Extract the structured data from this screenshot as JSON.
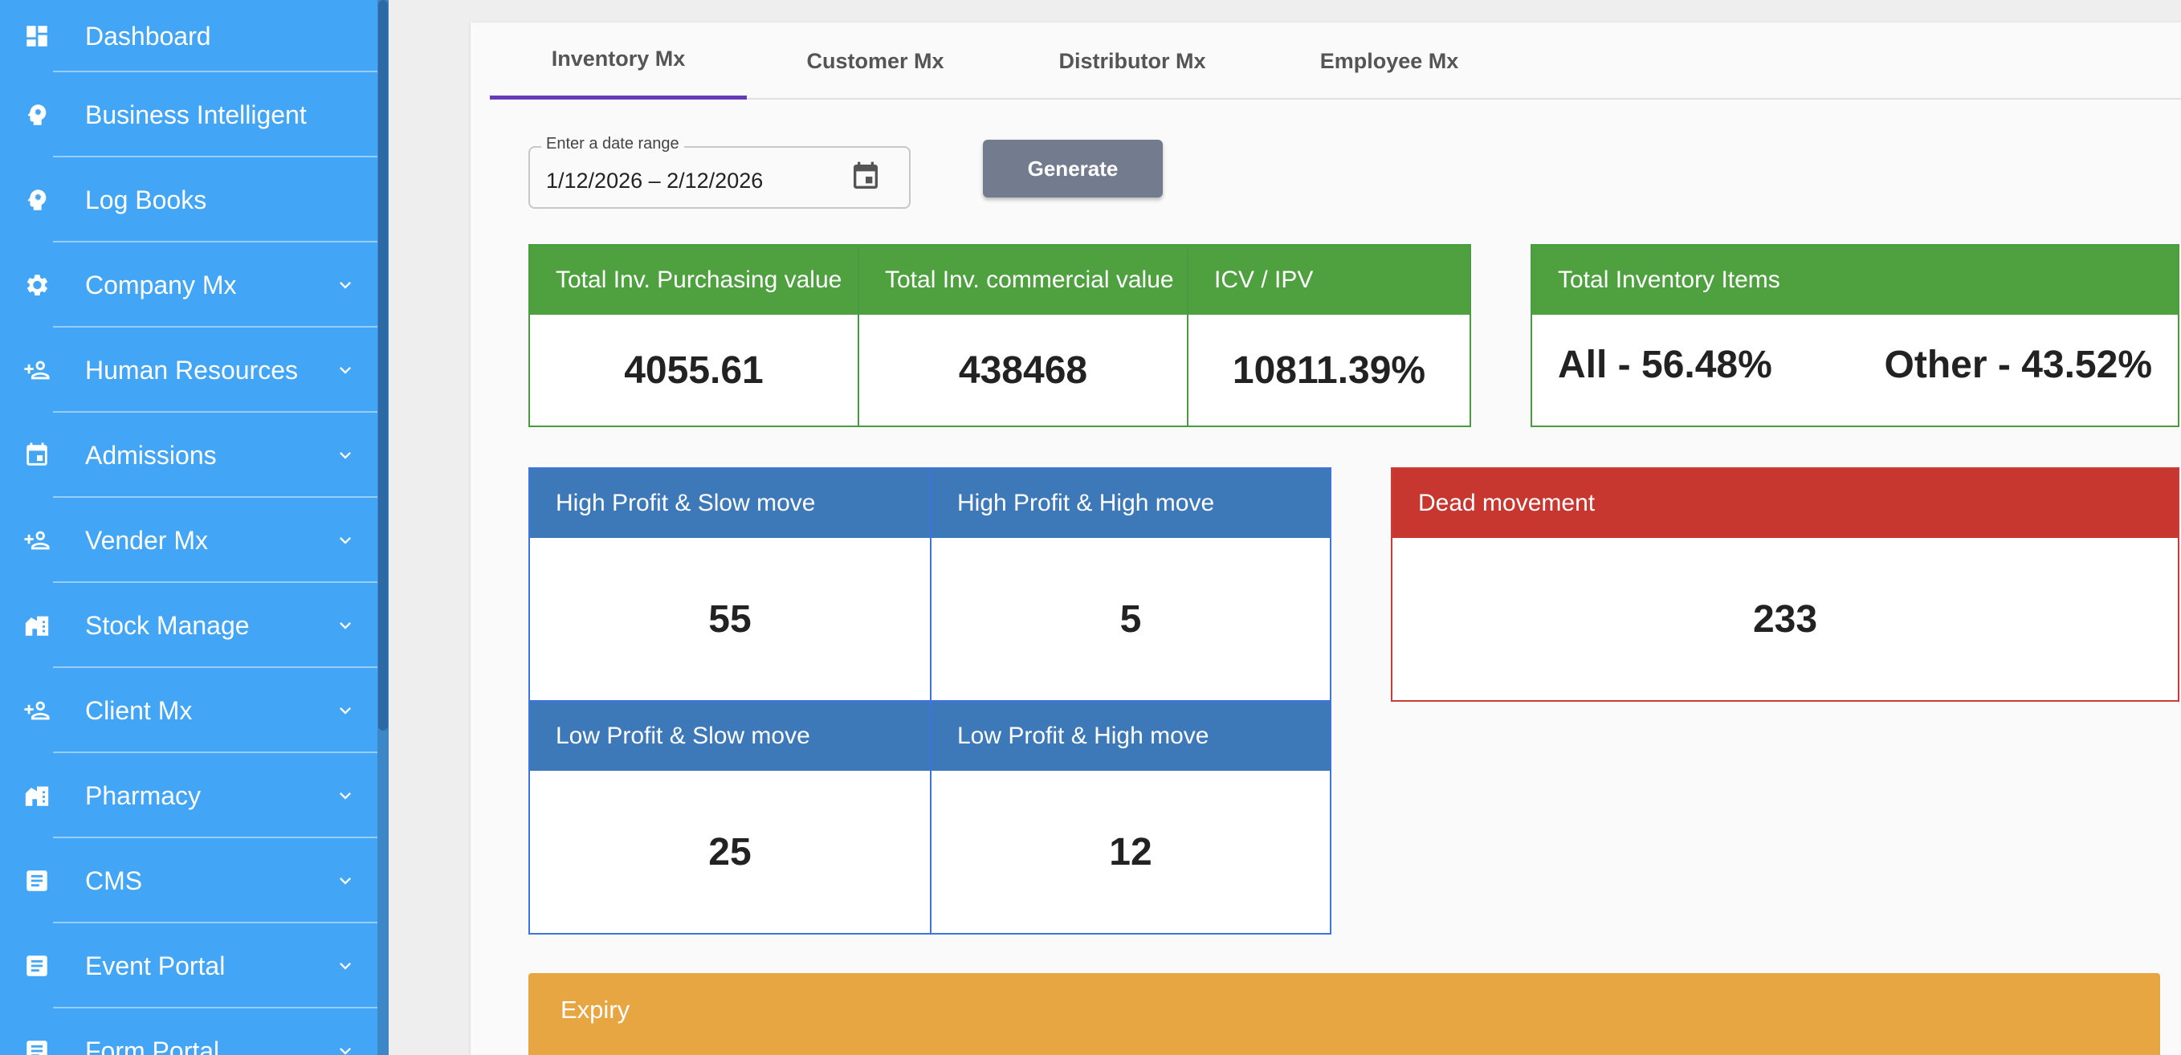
{
  "sidebar": {
    "items": [
      {
        "label": "Dashboard",
        "icon": "dashboard-icon",
        "expandable": false
      },
      {
        "label": "Business Intelligent",
        "icon": "brain-icon",
        "expandable": false
      },
      {
        "label": "Log Books",
        "icon": "brain-icon",
        "expandable": false
      },
      {
        "label": "Company Mx",
        "icon": "gear-icon",
        "expandable": true
      },
      {
        "label": "Human Resources",
        "icon": "person-add-icon",
        "expandable": true
      },
      {
        "label": "Admissions",
        "icon": "calendar-icon",
        "expandable": true
      },
      {
        "label": "Vender Mx",
        "icon": "person-add-icon",
        "expandable": true
      },
      {
        "label": "Stock Manage",
        "icon": "store-icon",
        "expandable": true
      },
      {
        "label": "Client Mx",
        "icon": "person-add-icon",
        "expandable": true
      },
      {
        "label": "Pharmacy",
        "icon": "store-icon",
        "expandable": true
      },
      {
        "label": "CMS",
        "icon": "document-icon",
        "expandable": true
      },
      {
        "label": "Event Portal",
        "icon": "document-icon",
        "expandable": true
      },
      {
        "label": "Form Portal",
        "icon": "document-icon",
        "expandable": true
      }
    ]
  },
  "tabs": [
    {
      "label": "Inventory Mx",
      "active": true
    },
    {
      "label": "Customer Mx",
      "active": false
    },
    {
      "label": "Distributor Mx",
      "active": false
    },
    {
      "label": "Employee Mx",
      "active": false
    }
  ],
  "date_range": {
    "label": "Enter a date range",
    "value": "1/12/2026 – 2/12/2026"
  },
  "generate_label": "Generate",
  "stats": {
    "purchasing": {
      "title": "Total Inv. Purchasing value",
      "value": "4055.61"
    },
    "commercial": {
      "title": "Total Inv. commercial value",
      "value": "438468"
    },
    "ratio": {
      "title": "ICV / IPV",
      "value": "10811.39%"
    },
    "items": {
      "title": "Total Inventory Items",
      "all": "All - 56.48%",
      "other": "Other - 43.52%"
    }
  },
  "matrix": {
    "hp_slow": {
      "title": "High Profit & Slow move",
      "value": "55"
    },
    "hp_high": {
      "title": "High Profit & High move",
      "value": "5"
    },
    "lp_slow": {
      "title": "Low Profit & Slow move",
      "value": "25"
    },
    "lp_high": {
      "title": "Low Profit & High move",
      "value": "12"
    }
  },
  "dead": {
    "title": "Dead movement",
    "value": "233"
  },
  "expiry": {
    "title": "Expiry"
  },
  "colors": {
    "sidebar": "#42a5f5",
    "green": "#4fa140",
    "blue": "#3d79b9",
    "red": "#c8372f",
    "orange": "#e8a642",
    "tab_indicator": "#673ab7",
    "button": "#737c8e"
  }
}
